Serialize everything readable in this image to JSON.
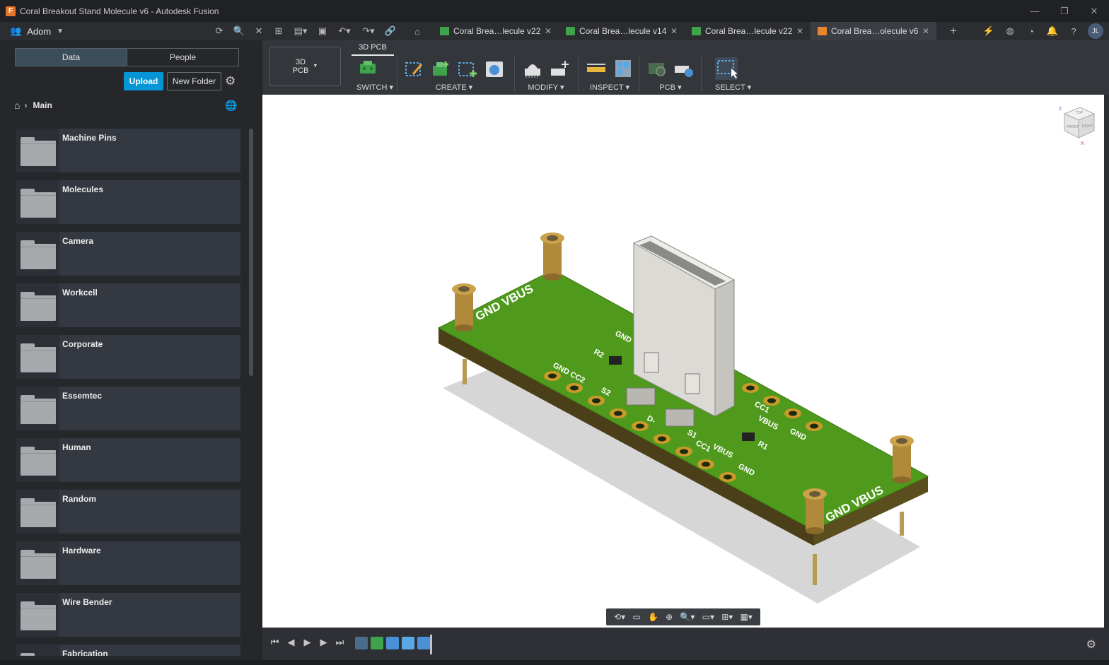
{
  "window": {
    "title": "Coral Breakout Stand Molecule v6 - Autodesk Fusion",
    "logo_letter": "F",
    "min": "—",
    "max": "❐",
    "close": "✕"
  },
  "topbar": {
    "team_name": "Adom",
    "tabs": [
      {
        "label": "Coral Brea…lecule v22",
        "icon": "pcb-icon",
        "active": false
      },
      {
        "label": "Coral Brea…lecule v14",
        "icon": "schematic-icon",
        "active": false
      },
      {
        "label": "Coral Brea…lecule v22",
        "icon": "pcb-icon",
        "active": false
      },
      {
        "label": "Coral Brea…olecule v6",
        "icon": "cube-icon",
        "active": true
      }
    ],
    "avatar_initials": "JL"
  },
  "data_panel": {
    "tabs": {
      "data": "Data",
      "people": "People"
    },
    "upload_label": "Upload",
    "new_folder_label": "New Folder",
    "breadcrumb": "Main",
    "folders": [
      "Machine Pins",
      "Molecules",
      "Camera",
      "Workcell",
      "Corporate",
      "Essemtec",
      "Human",
      "Random",
      "Hardware",
      "Wire Bender",
      "Fabrication"
    ]
  },
  "ribbon": {
    "workspace_line1": "3D",
    "workspace_line2": "PCB",
    "active_tab": "3D PCB",
    "groups": {
      "switch": "SWITCH",
      "create": "CREATE",
      "modify": "MODIFY",
      "inspect": "INSPECT",
      "pcb": "PCB",
      "select": "SELECT"
    }
  },
  "viewport": {
    "silkscreen": {
      "corner_tl": "GND VBUS",
      "corner_br": "GND VBUS",
      "left_row": "GND CC2",
      "s2": "S2",
      "r2": "R2",
      "d_minus": "D-",
      "s1": "S1",
      "cc1_bottom": "CC1",
      "vbus_bottom": "VBUS",
      "gnd_bottom": "GND",
      "cc1_right": "CC1",
      "vbus_right": "VBUS",
      "gnd_right": "GND",
      "r1": "R1",
      "gnd_top": "GND"
    },
    "viewcube": {
      "top": "TOP",
      "front": "FRONT",
      "right": "RIGHT",
      "x": "X",
      "z": "Z"
    }
  },
  "colors": {
    "accent": "#0696d7",
    "board_green": "#4f9a1c",
    "pad_gold": "#c99a2a",
    "connector_silver": "#dcdad5"
  }
}
